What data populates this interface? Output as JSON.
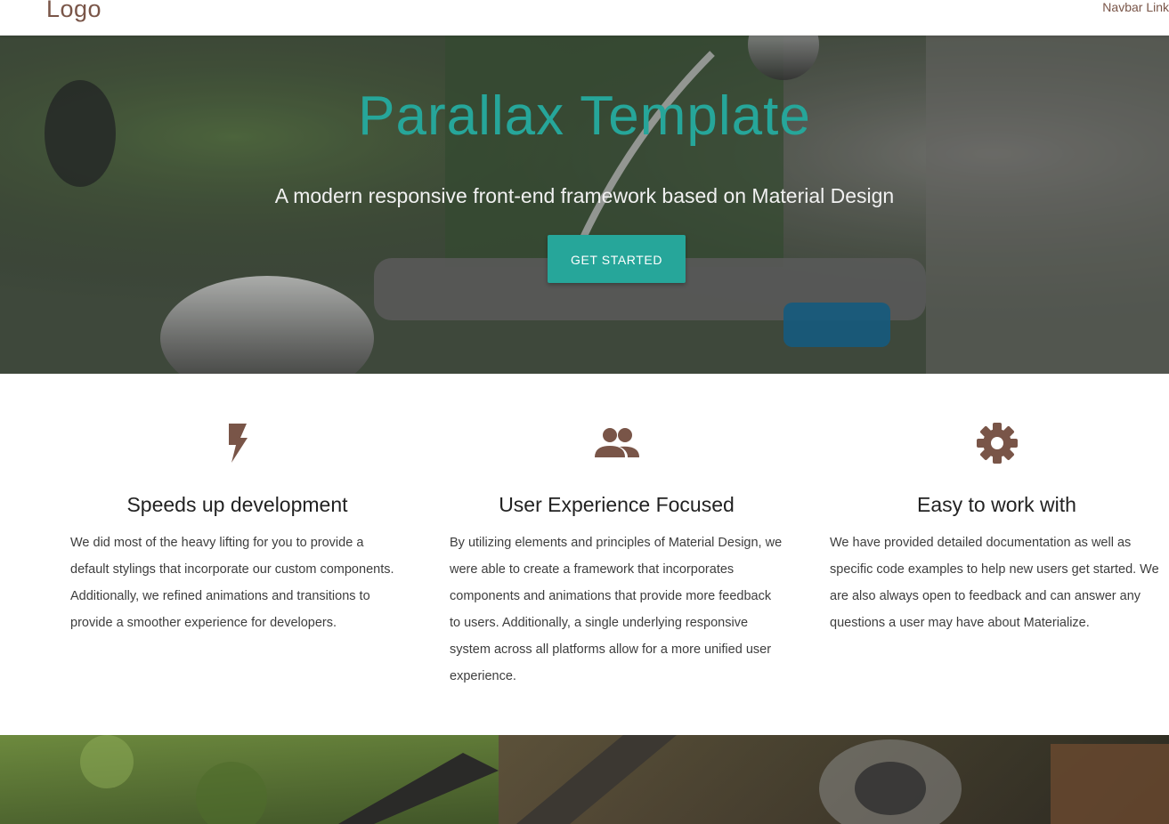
{
  "navbar": {
    "logo": "Logo",
    "link": "Navbar Link"
  },
  "hero": {
    "title": "Parallax Template",
    "subtitle": "A modern responsive front-end framework based on Material Design",
    "button": "GET STARTED"
  },
  "features": [
    {
      "icon": "flash-icon",
      "title": "Speeds up development",
      "text": "We did most of the heavy lifting for you to provide a default stylings that incorporate our custom components. Additionally, we refined animations and transitions to provide a smoother experience for developers."
    },
    {
      "icon": "group-icon",
      "title": "User Experience Focused",
      "text": "By utilizing elements and principles of Material Design, we were able to create a framework that incorporates components and animations that provide more feedback to users. Additionally, a single underlying responsive system across all platforms allow for a more unified user experience."
    },
    {
      "icon": "settings-icon",
      "title": "Easy to work with",
      "text": "We have provided detailed documentation as well as specific code examples to help new users get started. We are also always open to feedback and can answer any questions a user may have about Materialize."
    }
  ],
  "colors": {
    "accent": "#26a69a",
    "brown": "#795548"
  }
}
